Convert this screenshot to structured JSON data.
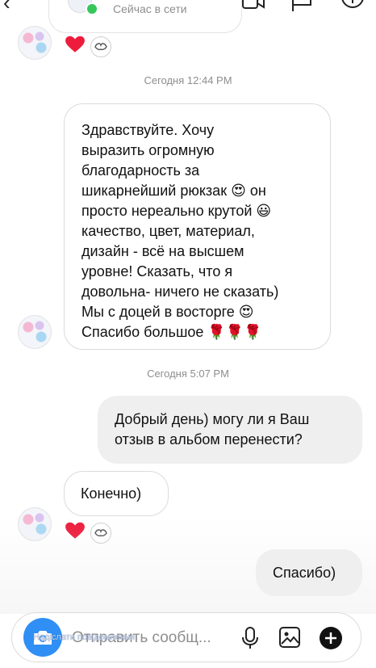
{
  "header": {
    "status": "Сейчас в сети",
    "colors": {
      "online": "#35c759"
    }
  },
  "messages": {
    "timestamp_1": "Сегодня 12:44 PM",
    "incoming_1_lines": [
      "Здравствуйте.  Хочу",
      "выразить огромную",
      "благодарность за",
      "шикарнейший рюкзак 😍 он",
      "просто нереально крутой 😃",
      "качество, цвет, материал,",
      "дизайн - всё на высшем",
      "уровне! Сказать, что я",
      "довольна- ничего не сказать)",
      "Мы с доцей в восторге 😍",
      "Спасибо большое 🌹🌹🌹"
    ],
    "timestamp_2": "Сегодня 5:07 PM",
    "outgoing_1_lines": [
      "Добрый день) могу ли я Ваш",
      "отзыв в альбом перенести?"
    ],
    "incoming_2": "Конечно)",
    "outgoing_2": "Спасибо)"
  },
  "composer": {
    "placeholder": "Отправить сообщ...",
    "hint": "Надіслати повідомлення",
    "icons": [
      "camera-icon",
      "microphone-icon",
      "gallery-icon",
      "add-icon"
    ],
    "accent": "#2f8ff5"
  },
  "reactions": {
    "heart_color": "#ed1c3c"
  }
}
